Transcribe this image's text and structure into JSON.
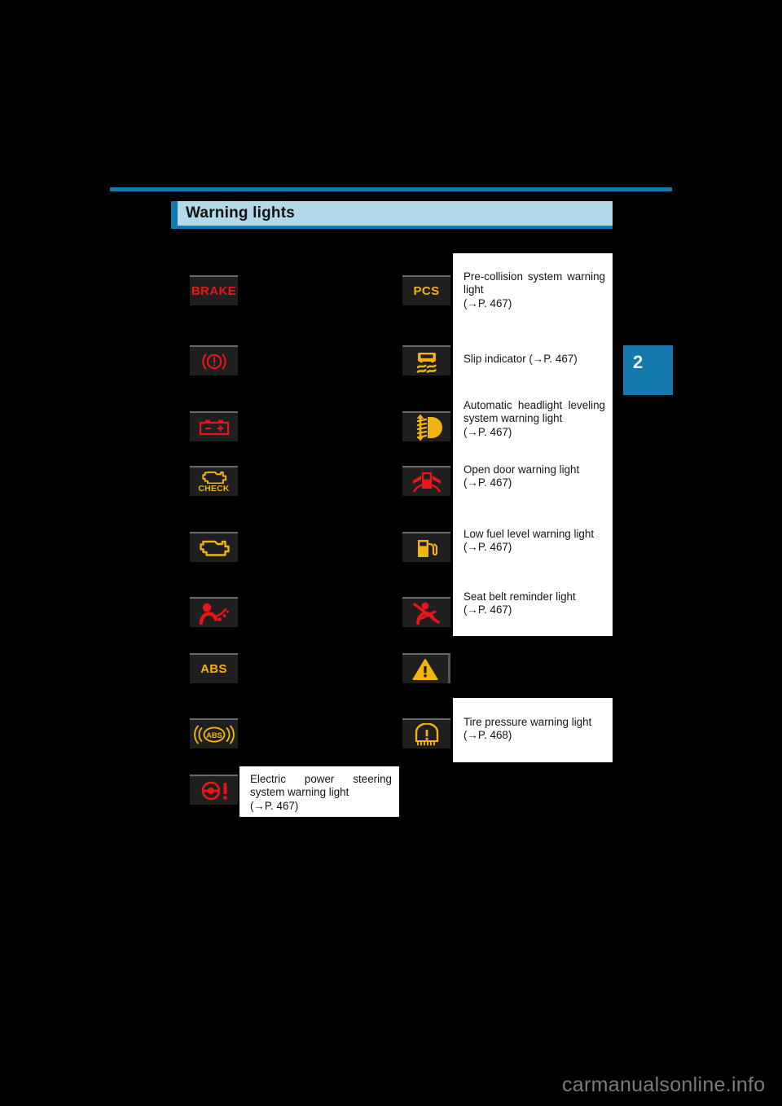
{
  "page": {
    "background_color": "#000000",
    "accent_color": "#1679ad",
    "title_bar_color": "#b3d9e8",
    "chapter_number": "2",
    "watermark": "carmanualsonline.info",
    "section_title": "Warning lights"
  },
  "colors": {
    "warning_red": "#e8161a",
    "warning_amber": "#f0b310",
    "icon_box_bg": "#1f1f1f",
    "callout_bg": "#ffffff"
  },
  "left_column": [
    {
      "icon_name": "brake-warning-light-icon",
      "icon_kind": "text",
      "text": "BRAKE",
      "color": "red"
    },
    {
      "icon_name": "brake-system-warning-light-icon",
      "icon_kind": "brake-circle",
      "text": "",
      "color": "red"
    },
    {
      "icon_name": "charging-system-warning-light-icon",
      "icon_kind": "battery",
      "text": "",
      "color": "red"
    },
    {
      "icon_name": "engine-check-warning-light-icon",
      "icon_kind": "engine-check",
      "text": "CHECK",
      "color": "amber"
    },
    {
      "icon_name": "malfunction-indicator-lamp-icon",
      "icon_kind": "engine",
      "text": "",
      "color": "amber"
    },
    {
      "icon_name": "srs-airbag-warning-light-icon",
      "icon_kind": "airbag",
      "text": "",
      "color": "red"
    },
    {
      "icon_name": "abs-warning-light-icon",
      "icon_kind": "text",
      "text": "ABS",
      "color": "amber"
    },
    {
      "icon_name": "brake-assist-warning-light-icon",
      "icon_kind": "abs-oval",
      "text": "ABS",
      "color": "amber"
    },
    {
      "icon_name": "electric-power-steering-warning-light-icon",
      "icon_kind": "steering",
      "text": "",
      "color": "red"
    }
  ],
  "right_column": [
    {
      "icon_name": "pre-collision-system-warning-light-icon",
      "icon_kind": "text",
      "text": "PCS",
      "color": "amber"
    },
    {
      "icon_name": "slip-indicator-icon",
      "icon_kind": "slip",
      "text": "",
      "color": "amber"
    },
    {
      "icon_name": "headlight-leveling-warning-light-icon",
      "icon_kind": "headlight-level",
      "text": "",
      "color": "amber"
    },
    {
      "icon_name": "open-door-warning-light-icon",
      "icon_kind": "open-door",
      "text": "",
      "color": "red"
    },
    {
      "icon_name": "low-fuel-level-warning-light-icon",
      "icon_kind": "fuel",
      "text": "",
      "color": "amber"
    },
    {
      "icon_name": "seat-belt-reminder-light-icon",
      "icon_kind": "seatbelt",
      "text": "",
      "color": "red"
    },
    {
      "icon_name": "master-warning-light-icon",
      "icon_kind": "triangle",
      "text": "",
      "color": "amber"
    },
    {
      "icon_name": "tire-pressure-warning-light-icon",
      "icon_kind": "tire-pressure",
      "text": "",
      "color": "amber"
    }
  ],
  "callouts": {
    "right_group": {
      "items": [
        {
          "label": "Pre-collision system warning light",
          "reference": "(→P. 467)",
          "justify": true
        },
        {
          "label": "Slip indicator (→P. 467)",
          "reference": "",
          "justify": false
        },
        {
          "label": "Automatic headlight leveling system warning light",
          "reference": "(→P. 467)",
          "justify": true
        },
        {
          "label": "Open door warning light",
          "reference": "(→P. 467)",
          "justify": false
        },
        {
          "label": "Low fuel level warning light",
          "reference": "(→P. 467)",
          "justify": false
        },
        {
          "label": "Seat belt reminder light",
          "reference": "(→P. 467)",
          "justify": true
        }
      ]
    },
    "tire_pressure": {
      "label": "Tire pressure warning light",
      "reference": "(→P. 468)"
    },
    "electric_power_steering": {
      "label": "Electric power steering system warning light",
      "reference": "(→P. 467)"
    }
  }
}
